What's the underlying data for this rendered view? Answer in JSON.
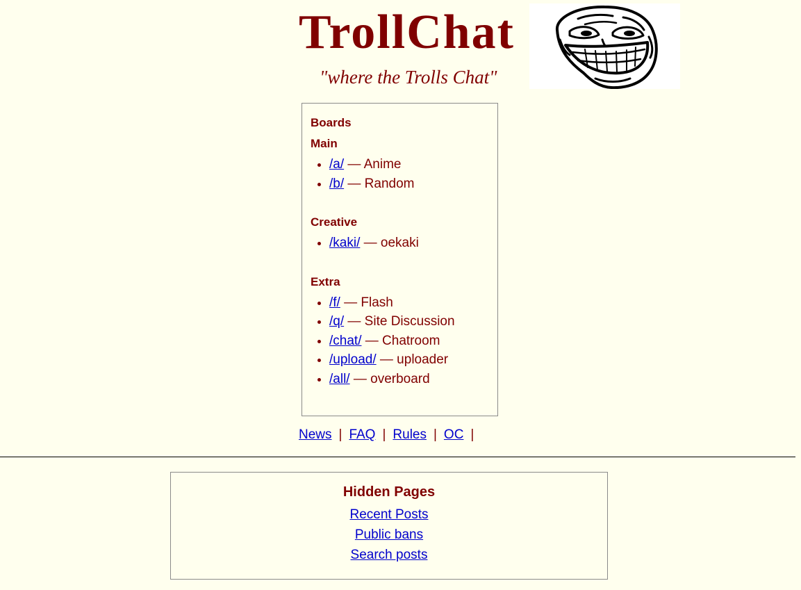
{
  "header": {
    "title": "TrollChat",
    "tagline": "\"where the Trolls Chat\""
  },
  "boards": {
    "heading": "Boards",
    "sections": [
      {
        "name": "Main",
        "items": [
          {
            "link": "/a/",
            "desc": "— Anime"
          },
          {
            "link": "/b/",
            "desc": "— Random"
          }
        ]
      },
      {
        "name": "Creative",
        "items": [
          {
            "link": "/kaki/",
            "desc": "— oekaki"
          }
        ]
      },
      {
        "name": "Extra",
        "items": [
          {
            "link": "/f/",
            "desc": "— Flash"
          },
          {
            "link": "/q/",
            "desc": "— Site Discussion"
          },
          {
            "link": "/chat/",
            "desc": "— Chatroom"
          },
          {
            "link": "/upload/",
            "desc": "— uploader"
          },
          {
            "link": "/all/",
            "desc": "— overboard"
          }
        ]
      }
    ]
  },
  "nav": {
    "links": [
      "News",
      "FAQ",
      "Rules",
      "OC"
    ],
    "separator": "|"
  },
  "hidden_pages": {
    "title": "Hidden Pages",
    "links": [
      "Recent Posts",
      "Public bans",
      "Search posts"
    ]
  },
  "colors": {
    "background": "#ffffee",
    "text": "#800000",
    "link": "#0000cc"
  },
  "icons": {
    "logo": "trollface-logo"
  }
}
